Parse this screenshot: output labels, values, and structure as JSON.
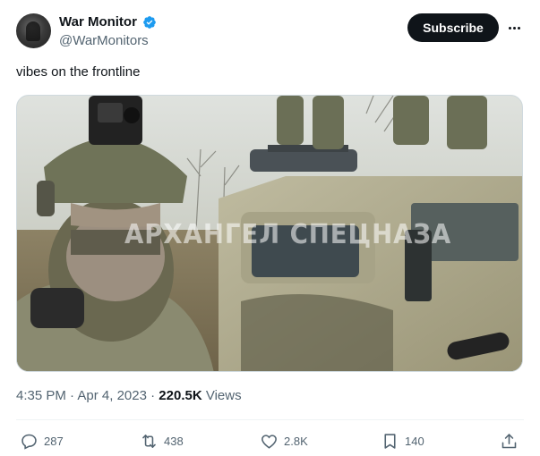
{
  "author": {
    "display_name": "War Monitor",
    "handle": "@WarMonitors"
  },
  "subscribe_label": "Subscribe",
  "post": {
    "text": "vibes on the frontline",
    "watermark": "АРХАНГЕЛ СПЕЦНАЗА",
    "time": "4:35 PM",
    "date": "Apr 4, 2023",
    "views_count": "220.5K",
    "views_label": "Views"
  },
  "actions": {
    "replies": "287",
    "reposts": "438",
    "likes": "2.8K",
    "bookmarks": "140"
  },
  "colors": {
    "verified": "#1d9bf0",
    "secondary_text": "#536471",
    "primary_text": "#0f1419"
  }
}
